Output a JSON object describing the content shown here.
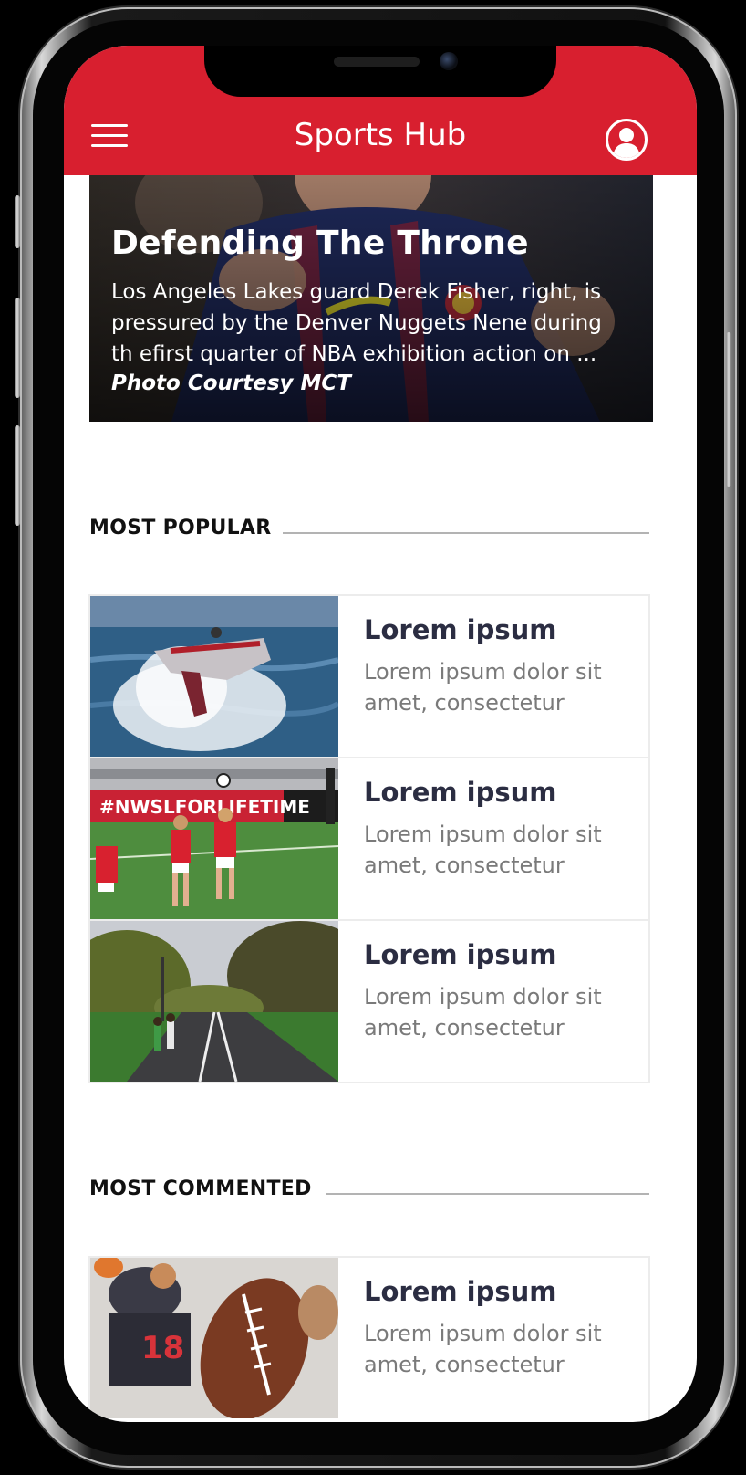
{
  "app": {
    "title": "Sports Hub"
  },
  "hero": {
    "title": "Defending The Throne",
    "description_lines": [
      "Los Angeles Lakes guard Derek Fisher, right, is",
      "pressured by the Denver Nuggets Nene during",
      "th efirst quarter of NBA exhibition action on ..."
    ],
    "credit": "Photo Courtesy MCT"
  },
  "sections": {
    "popular": {
      "label": "MOST POPULAR",
      "items": [
        {
          "title": "Lorem ipsum",
          "text_lines": [
            "Lorem ipsum dolor sit",
            "amet, consectetur"
          ],
          "image": "jet-ski-photo"
        },
        {
          "title": "Lorem ipsum",
          "text_lines": [
            "Lorem ipsum dolor sit",
            "amet, consectetur"
          ],
          "image": "soccer-photo"
        },
        {
          "title": "Lorem ipsum",
          "text_lines": [
            "Lorem ipsum dolor sit",
            "amet, consectetur"
          ],
          "image": "park-road-photo"
        }
      ]
    },
    "commented": {
      "label": "MOST COMMENTED",
      "items": [
        {
          "title": "Lorem ipsum",
          "text_lines": [
            "Lorem ipsum dolor sit",
            "amet, consectetur"
          ],
          "image": "football-photo"
        }
      ]
    }
  },
  "colors": {
    "brand": "#d81f2f",
    "title_text": "#2b2d42",
    "body_text": "#7a7a7a"
  },
  "icons": {
    "menu": "hamburger-menu-icon",
    "profile": "user-profile-icon"
  }
}
